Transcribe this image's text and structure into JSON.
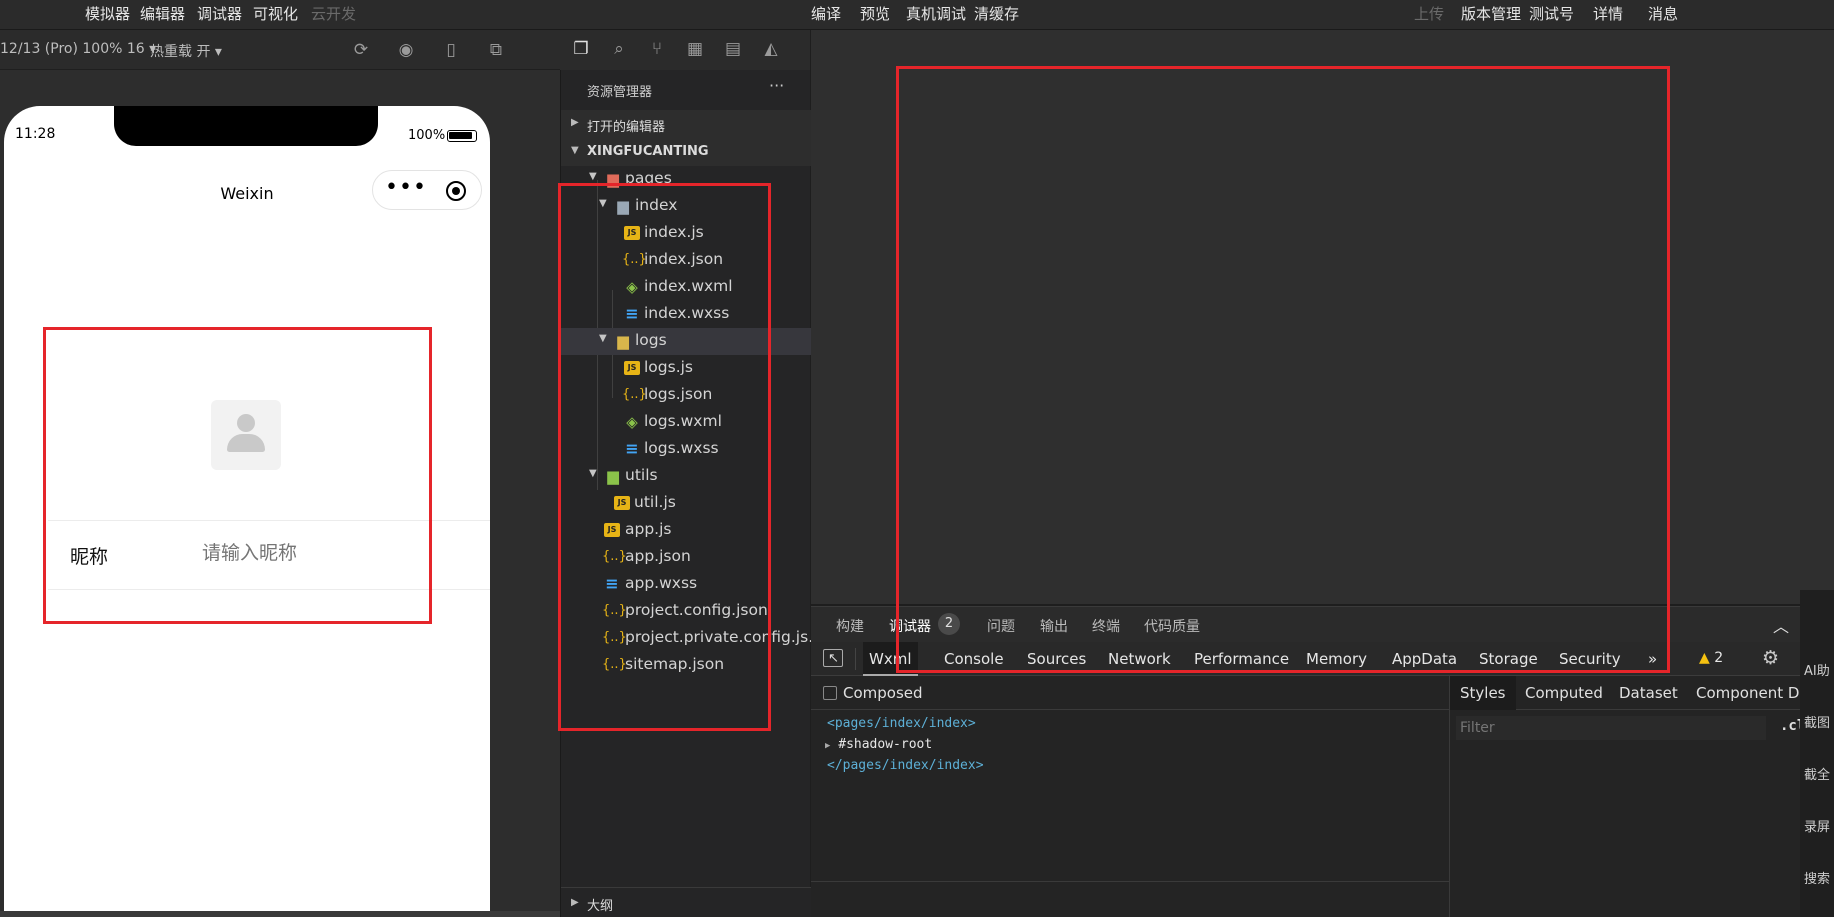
{
  "menu": {
    "left": [
      "模拟器",
      "编辑器",
      "调试器",
      "可视化",
      "云开发"
    ],
    "center": [
      "编译",
      "预览",
      "真机调试",
      "清缓存"
    ],
    "right": [
      "上传",
      "版本管理",
      "测试号",
      "详情",
      "消息"
    ]
  },
  "sim_toolbar": {
    "device": "12/13 (Pro) 100% 16 ▾",
    "hot_reload": "热重载 开 ▾",
    "icons": [
      "refresh-icon",
      "stop-icon",
      "phone-icon",
      "window-icon"
    ]
  },
  "phone": {
    "time": "11:28",
    "battery": "100%",
    "title": "Weixin",
    "capsule_dots": "•••",
    "nickname_label": "昵称",
    "nickname_placeholder": "请输入昵称"
  },
  "activity_icons": [
    "files-icon",
    "search-icon",
    "git-branch-icon",
    "extensions-icon",
    "storage-icon",
    "docker-icon"
  ],
  "explorer": {
    "header": "资源管理器",
    "more": "···",
    "open_editors": "打开的编辑器",
    "project": "XINGFUCANTING",
    "outline": "大纲",
    "tree": [
      {
        "name": "pages",
        "type": "folder-red"
      },
      {
        "name": "index",
        "type": "folder"
      },
      {
        "name": "index.js",
        "type": "js"
      },
      {
        "name": "index.json",
        "type": "json"
      },
      {
        "name": "index.wxml",
        "type": "wxml"
      },
      {
        "name": "index.wxss",
        "type": "wxss"
      },
      {
        "name": "logs",
        "type": "folder-y"
      },
      {
        "name": "logs.js",
        "type": "js"
      },
      {
        "name": "logs.json",
        "type": "json"
      },
      {
        "name": "logs.wxml",
        "type": "wxml"
      },
      {
        "name": "logs.wxss",
        "type": "wxss"
      },
      {
        "name": "utils",
        "type": "folder-g"
      },
      {
        "name": "util.js",
        "type": "js"
      },
      {
        "name": "app.js",
        "type": "js"
      },
      {
        "name": "app.json",
        "type": "json"
      },
      {
        "name": "app.wxss",
        "type": "wxss"
      },
      {
        "name": "project.config.json",
        "type": "json"
      },
      {
        "name": "project.private.config.js...",
        "type": "json"
      },
      {
        "name": "sitemap.json",
        "type": "json"
      }
    ]
  },
  "debugger": {
    "tabs": [
      "构建",
      "调试器",
      "问题",
      "输出",
      "终端",
      "代码质量"
    ],
    "badge": "2",
    "collapse": "︿",
    "devtools_tabs": [
      "Wxml",
      "Console",
      "Sources",
      "Network",
      "Performance",
      "Memory",
      "AppData",
      "Storage",
      "Security"
    ],
    "more": "»",
    "warnings": "2",
    "warn_icon": "▲",
    "gear": "⚙",
    "kebab": "⋮",
    "composed": "Composed",
    "code": [
      "<pages/index/index>",
      "#shadow-root",
      "</pages/index/index>"
    ],
    "styles_tabs": [
      "Styles",
      "Computed",
      "Dataset",
      "Component Data"
    ],
    "filter_placeholder": "Filter",
    "cls": ".cls"
  },
  "right_rail": [
    "AI助",
    "截图",
    "截全",
    "录屏",
    "搜索"
  ],
  "colors": {
    "highlight_box": "#e5252a",
    "tag": "#5db0d7",
    "js_icon": "#e7b416",
    "wxml_icon": "#8bc34a",
    "wxss_icon": "#42a5f5"
  }
}
